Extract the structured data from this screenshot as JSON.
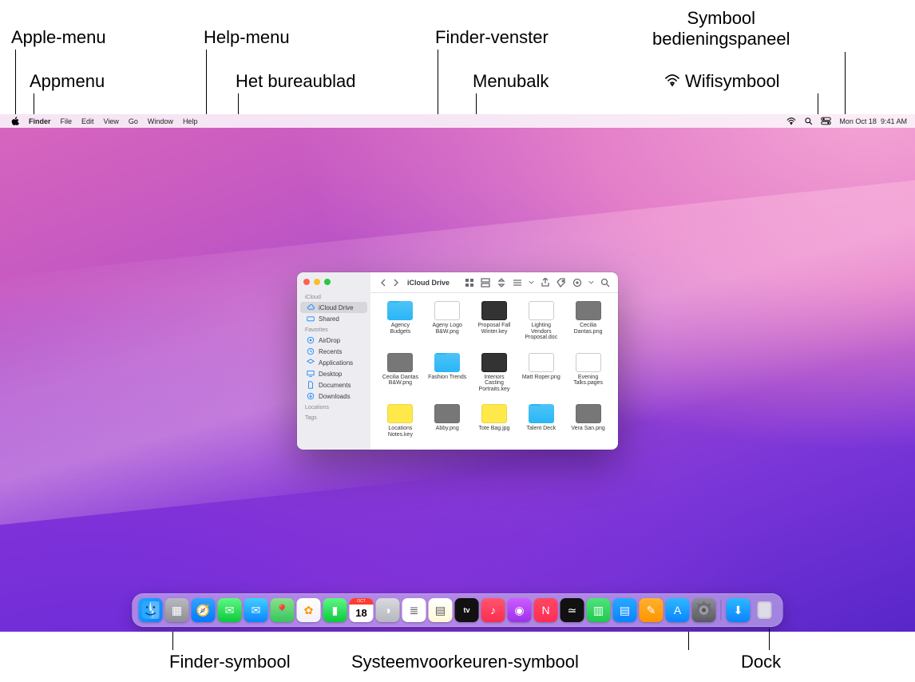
{
  "annotations": {
    "apple_menu": "Apple-menu",
    "app_menu": "Appmenu",
    "help_menu": "Help-menu",
    "desktop": "Het bureaublad",
    "finder_window": "Finder-venster",
    "menubar": "Menubalk",
    "control_center": "Symbool\nbedieningspaneel",
    "wifi": "Wifisymbool",
    "finder_icon": "Finder-symbool",
    "sysprefs_icon": "Systeemvoorkeuren-symbool",
    "dock": "Dock"
  },
  "menubar": {
    "apple": "apple-logo",
    "app": "Finder",
    "items": [
      "File",
      "Edit",
      "View",
      "Go",
      "Window",
      "Help"
    ],
    "status": {
      "wifi": "wifi-icon",
      "spotlight": "spotlight-icon",
      "control_center": "control-center-icon",
      "date": "Mon Oct 18",
      "time": "9:41 AM"
    }
  },
  "finder": {
    "title": "iCloud Drive",
    "sidebar": {
      "sections": [
        {
          "header": "iCloud",
          "items": [
            {
              "icon": "cloud",
              "label": "iCloud Drive",
              "selected": true
            },
            {
              "icon": "shared",
              "label": "Shared"
            }
          ]
        },
        {
          "header": "Favorites",
          "items": [
            {
              "icon": "airdrop",
              "label": "AirDrop"
            },
            {
              "icon": "recents",
              "label": "Recents"
            },
            {
              "icon": "apps",
              "label": "Applications"
            },
            {
              "icon": "desktop",
              "label": "Desktop"
            },
            {
              "icon": "docs",
              "label": "Documents"
            },
            {
              "icon": "downloads",
              "label": "Downloads"
            }
          ]
        },
        {
          "header": "Locations",
          "items": []
        },
        {
          "header": "Tags",
          "items": []
        }
      ]
    },
    "items": [
      {
        "kind": "folder",
        "label": "Agency Budgets"
      },
      {
        "kind": "doc",
        "label": "Ageny Logo B&W.png"
      },
      {
        "kind": "key",
        "label": "Proposal Fall Winter.key"
      },
      {
        "kind": "doc",
        "label": "Lighting Vendors Proposal.doc"
      },
      {
        "kind": "photo",
        "label": "Cecilia Dantas.png"
      },
      {
        "kind": "photo",
        "label": "Cecilia Dantas B&W.png"
      },
      {
        "kind": "folder",
        "label": "Fashion Trends"
      },
      {
        "kind": "key",
        "label": "Interiors Casting Portraits.key"
      },
      {
        "kind": "doc",
        "label": "Matt Roper.png"
      },
      {
        "kind": "doc",
        "label": "Evening Talks.pages"
      },
      {
        "kind": "yellow",
        "label": "Locations Notes.key"
      },
      {
        "kind": "photo",
        "label": "Abby.png"
      },
      {
        "kind": "yellow",
        "label": "Tote Bag.jpg"
      },
      {
        "kind": "folder",
        "label": "Talent Deck"
      },
      {
        "kind": "photo",
        "label": "Vera San.png"
      }
    ]
  },
  "dock": {
    "apps": [
      {
        "name": "Finder",
        "bg": "linear-gradient(135deg,#1fa4ff,#0a84ff)"
      },
      {
        "name": "Launchpad",
        "bg": "linear-gradient(#b8b8c0,#8e8e98)"
      },
      {
        "name": "Safari",
        "bg": "linear-gradient(#35a3ff,#007aff)"
      },
      {
        "name": "Messages",
        "bg": "linear-gradient(#5ef783,#0bca3c)"
      },
      {
        "name": "Mail",
        "bg": "linear-gradient(#3fd0ff,#0a84ff)"
      },
      {
        "name": "Maps",
        "bg": "linear-gradient(#8be08c,#34c759)"
      },
      {
        "name": "Photos",
        "bg": "linear-gradient(#fff,#f2f2f7)"
      },
      {
        "name": "FaceTime",
        "bg": "linear-gradient(#5ef783,#0bca3c)"
      },
      {
        "name": "Calendar",
        "bg": "#ffffff",
        "text": "18",
        "top": "#ff3b30"
      },
      {
        "name": "Contacts",
        "bg": "linear-gradient(#d9d9df,#b6b6be)"
      },
      {
        "name": "Reminders",
        "bg": "#ffffff"
      },
      {
        "name": "Notes",
        "bg": "linear-gradient(#fff,#fff8d6)"
      },
      {
        "name": "TV",
        "bg": "#111"
      },
      {
        "name": "Music",
        "bg": "linear-gradient(#ff5670,#fb2d4d)"
      },
      {
        "name": "Podcasts",
        "bg": "linear-gradient(#ce5cff,#9a33ea)"
      },
      {
        "name": "News",
        "bg": "linear-gradient(#ff4763,#ff2d55)"
      },
      {
        "name": "Stocks",
        "bg": "#111"
      },
      {
        "name": "Numbers",
        "bg": "linear-gradient(#4fe37a,#1ec94e)"
      },
      {
        "name": "Keynote",
        "bg": "linear-gradient(#28a9ff,#0a84ff)"
      },
      {
        "name": "Pages",
        "bg": "linear-gradient(#ffb02e,#ff9500)"
      },
      {
        "name": "App Store",
        "bg": "linear-gradient(#2eb8ff,#0a84ff)"
      },
      {
        "name": "System Preferences",
        "bg": "linear-gradient(#8e8e98,#5a5a62)"
      }
    ],
    "rightSide": [
      {
        "name": "Downloads",
        "bg": "linear-gradient(#2eb8ff,#0a84ff)"
      }
    ]
  }
}
